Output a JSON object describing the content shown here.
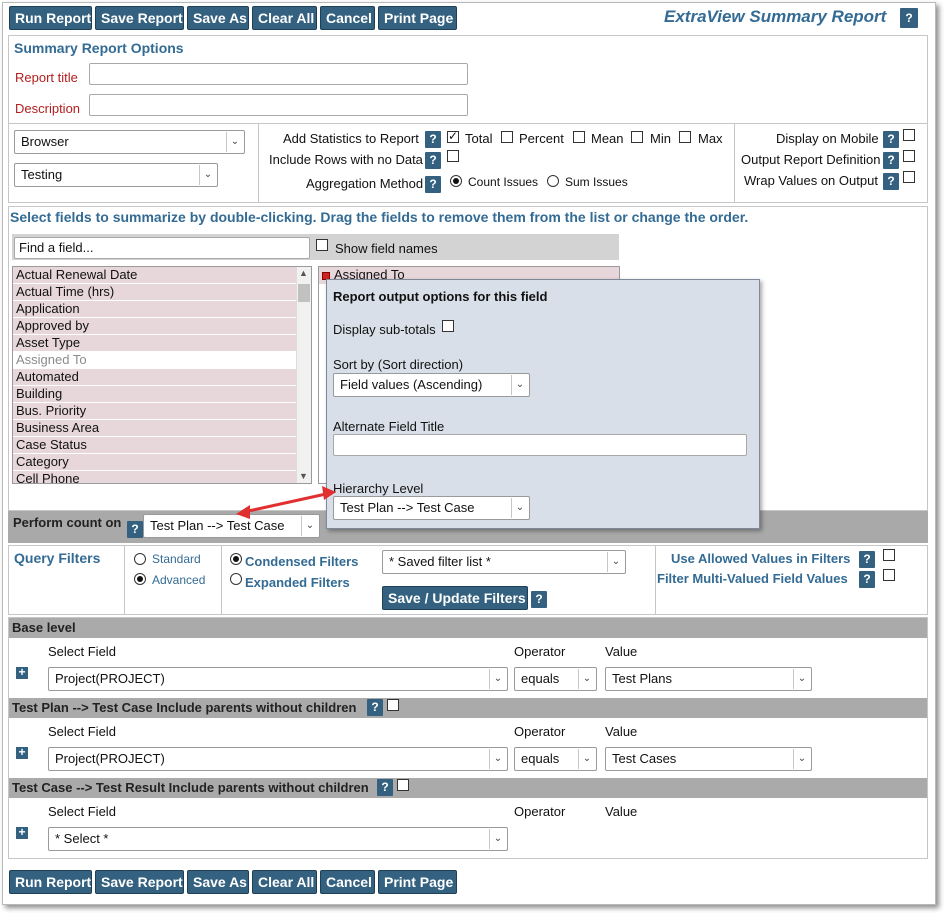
{
  "toolbar": {
    "buttons": [
      "Run Report",
      "Save Report",
      "Save As",
      "Clear All",
      "Cancel",
      "Print Page"
    ],
    "report_title": "ExtraView Summary Report",
    "help": "?"
  },
  "options": {
    "section_title": "Summary Report Options",
    "report_title_label": "Report title",
    "report_title_value": "",
    "description_label": "Description",
    "description_value": "",
    "output_select": "Browser",
    "layout_select": "Testing",
    "add_statistics_label": "Add Statistics to Report",
    "stats": {
      "total": "Total",
      "percent": "Percent",
      "mean": "Mean",
      "min": "Min",
      "max": "Max"
    },
    "include_rows_label": "Include Rows with no Data",
    "aggregation_label": "Aggregation Method",
    "count_issues": "Count Issues",
    "sum_issues": "Sum Issues",
    "display_mobile": "Display on Mobile",
    "output_definition": "Output Report Definition",
    "wrap_values": "Wrap Values on Output"
  },
  "fields": {
    "instruction": "Select fields to summarize by double-clicking. Drag the fields to remove them from the list or change the order.",
    "find_placeholder": "Find a field...",
    "show_field_names": "Show field names",
    "available": [
      "Actual Renewal Date",
      "Actual Time (hrs)",
      "Application",
      "Approved by",
      "Asset Type",
      "Assigned To",
      "Automated",
      "Building",
      "Bus. Priority",
      "Business Area",
      "Case Status",
      "Category",
      "Cell Phone"
    ],
    "selected": [
      "Assigned To"
    ]
  },
  "popup": {
    "title": "Report output options for this field",
    "subtotals_label": "Display sub-totals",
    "sort_label": "Sort by (Sort direction)",
    "sort_value": "Field values (Ascending)",
    "alt_title_label": "Alternate Field Title",
    "alt_title_value": "",
    "hierarchy_label": "Hierarchy Level",
    "hierarchy_value": "Test Plan --> Test Case"
  },
  "perform_count": {
    "label": "Perform count on",
    "value": "Test Plan --> Test Case"
  },
  "query_filters": {
    "title": "Query Filters",
    "standard": "Standard",
    "advanced": "Advanced",
    "condensed": "Condensed Filters",
    "expanded": "Expanded Filters",
    "saved_filter": "* Saved filter list *",
    "save_update_button": "Save / Update Filters",
    "use_allowed": "Use Allowed Values in Filters",
    "filter_multi": "Filter Multi-Valued Field Values"
  },
  "levels": [
    {
      "title": "Base level",
      "select_field_header": "Select Field",
      "operator_header": "Operator",
      "value_header": "Value",
      "field": "Project(PROJECT)",
      "operator": "equals",
      "value": "Test Plans"
    },
    {
      "title": "Test Plan --> Test Case Include parents without children",
      "select_field_header": "Select Field",
      "operator_header": "Operator",
      "value_header": "Value",
      "field": "Project(PROJECT)",
      "operator": "equals",
      "value": "Test Cases"
    },
    {
      "title": "Test Case --> Test Result Include parents without children",
      "select_field_header": "Select Field",
      "operator_header": "Operator",
      "value_header": "Value",
      "field": "* Select *"
    }
  ],
  "colors": {
    "button_bg": "#33617f",
    "section_title": "#336b94",
    "accent_red": "#e03030",
    "level_bar": "#aaaaaa"
  }
}
